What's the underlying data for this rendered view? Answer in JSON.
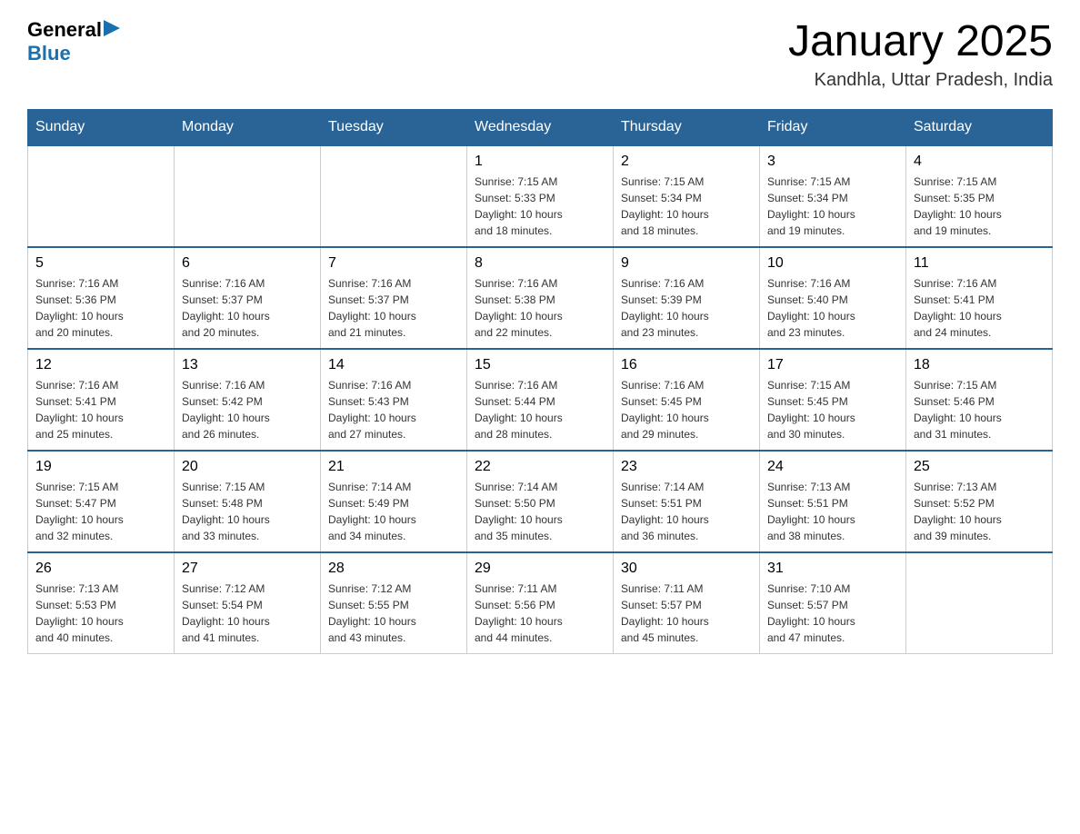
{
  "header": {
    "logo_general": "General",
    "logo_blue": "Blue",
    "title": "January 2025",
    "subtitle": "Kandhla, Uttar Pradesh, India"
  },
  "weekdays": [
    "Sunday",
    "Monday",
    "Tuesday",
    "Wednesday",
    "Thursday",
    "Friday",
    "Saturday"
  ],
  "weeks": [
    [
      {
        "day": "",
        "info": ""
      },
      {
        "day": "",
        "info": ""
      },
      {
        "day": "",
        "info": ""
      },
      {
        "day": "1",
        "info": "Sunrise: 7:15 AM\nSunset: 5:33 PM\nDaylight: 10 hours\nand 18 minutes."
      },
      {
        "day": "2",
        "info": "Sunrise: 7:15 AM\nSunset: 5:34 PM\nDaylight: 10 hours\nand 18 minutes."
      },
      {
        "day": "3",
        "info": "Sunrise: 7:15 AM\nSunset: 5:34 PM\nDaylight: 10 hours\nand 19 minutes."
      },
      {
        "day": "4",
        "info": "Sunrise: 7:15 AM\nSunset: 5:35 PM\nDaylight: 10 hours\nand 19 minutes."
      }
    ],
    [
      {
        "day": "5",
        "info": "Sunrise: 7:16 AM\nSunset: 5:36 PM\nDaylight: 10 hours\nand 20 minutes."
      },
      {
        "day": "6",
        "info": "Sunrise: 7:16 AM\nSunset: 5:37 PM\nDaylight: 10 hours\nand 20 minutes."
      },
      {
        "day": "7",
        "info": "Sunrise: 7:16 AM\nSunset: 5:37 PM\nDaylight: 10 hours\nand 21 minutes."
      },
      {
        "day": "8",
        "info": "Sunrise: 7:16 AM\nSunset: 5:38 PM\nDaylight: 10 hours\nand 22 minutes."
      },
      {
        "day": "9",
        "info": "Sunrise: 7:16 AM\nSunset: 5:39 PM\nDaylight: 10 hours\nand 23 minutes."
      },
      {
        "day": "10",
        "info": "Sunrise: 7:16 AM\nSunset: 5:40 PM\nDaylight: 10 hours\nand 23 minutes."
      },
      {
        "day": "11",
        "info": "Sunrise: 7:16 AM\nSunset: 5:41 PM\nDaylight: 10 hours\nand 24 minutes."
      }
    ],
    [
      {
        "day": "12",
        "info": "Sunrise: 7:16 AM\nSunset: 5:41 PM\nDaylight: 10 hours\nand 25 minutes."
      },
      {
        "day": "13",
        "info": "Sunrise: 7:16 AM\nSunset: 5:42 PM\nDaylight: 10 hours\nand 26 minutes."
      },
      {
        "day": "14",
        "info": "Sunrise: 7:16 AM\nSunset: 5:43 PM\nDaylight: 10 hours\nand 27 minutes."
      },
      {
        "day": "15",
        "info": "Sunrise: 7:16 AM\nSunset: 5:44 PM\nDaylight: 10 hours\nand 28 minutes."
      },
      {
        "day": "16",
        "info": "Sunrise: 7:16 AM\nSunset: 5:45 PM\nDaylight: 10 hours\nand 29 minutes."
      },
      {
        "day": "17",
        "info": "Sunrise: 7:15 AM\nSunset: 5:45 PM\nDaylight: 10 hours\nand 30 minutes."
      },
      {
        "day": "18",
        "info": "Sunrise: 7:15 AM\nSunset: 5:46 PM\nDaylight: 10 hours\nand 31 minutes."
      }
    ],
    [
      {
        "day": "19",
        "info": "Sunrise: 7:15 AM\nSunset: 5:47 PM\nDaylight: 10 hours\nand 32 minutes."
      },
      {
        "day": "20",
        "info": "Sunrise: 7:15 AM\nSunset: 5:48 PM\nDaylight: 10 hours\nand 33 minutes."
      },
      {
        "day": "21",
        "info": "Sunrise: 7:14 AM\nSunset: 5:49 PM\nDaylight: 10 hours\nand 34 minutes."
      },
      {
        "day": "22",
        "info": "Sunrise: 7:14 AM\nSunset: 5:50 PM\nDaylight: 10 hours\nand 35 minutes."
      },
      {
        "day": "23",
        "info": "Sunrise: 7:14 AM\nSunset: 5:51 PM\nDaylight: 10 hours\nand 36 minutes."
      },
      {
        "day": "24",
        "info": "Sunrise: 7:13 AM\nSunset: 5:51 PM\nDaylight: 10 hours\nand 38 minutes."
      },
      {
        "day": "25",
        "info": "Sunrise: 7:13 AM\nSunset: 5:52 PM\nDaylight: 10 hours\nand 39 minutes."
      }
    ],
    [
      {
        "day": "26",
        "info": "Sunrise: 7:13 AM\nSunset: 5:53 PM\nDaylight: 10 hours\nand 40 minutes."
      },
      {
        "day": "27",
        "info": "Sunrise: 7:12 AM\nSunset: 5:54 PM\nDaylight: 10 hours\nand 41 minutes."
      },
      {
        "day": "28",
        "info": "Sunrise: 7:12 AM\nSunset: 5:55 PM\nDaylight: 10 hours\nand 43 minutes."
      },
      {
        "day": "29",
        "info": "Sunrise: 7:11 AM\nSunset: 5:56 PM\nDaylight: 10 hours\nand 44 minutes."
      },
      {
        "day": "30",
        "info": "Sunrise: 7:11 AM\nSunset: 5:57 PM\nDaylight: 10 hours\nand 45 minutes."
      },
      {
        "day": "31",
        "info": "Sunrise: 7:10 AM\nSunset: 5:57 PM\nDaylight: 10 hours\nand 47 minutes."
      },
      {
        "day": "",
        "info": ""
      }
    ]
  ]
}
